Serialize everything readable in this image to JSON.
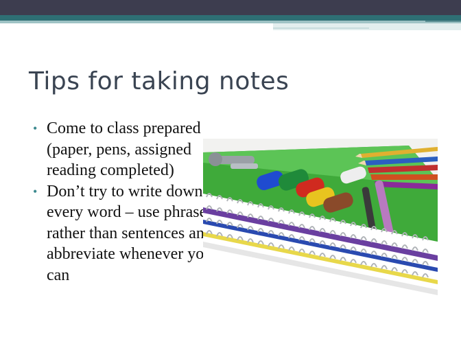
{
  "slide": {
    "title": "Tips for taking notes",
    "bullets": [
      "Come to class prepared (paper, pens, assigned reading completed)",
      "Don’t try to write down every word – use phrases rather than sentences and abbreviate whenever you can"
    ]
  },
  "colors": {
    "top_bar": "#3d3d4f",
    "accent_teal": "#2e6f74",
    "title_text": "#3a4452",
    "bullet": "#3d8a8f"
  },
  "photo": {
    "subject": "school-supplies-notebooks-markers-pencils"
  }
}
